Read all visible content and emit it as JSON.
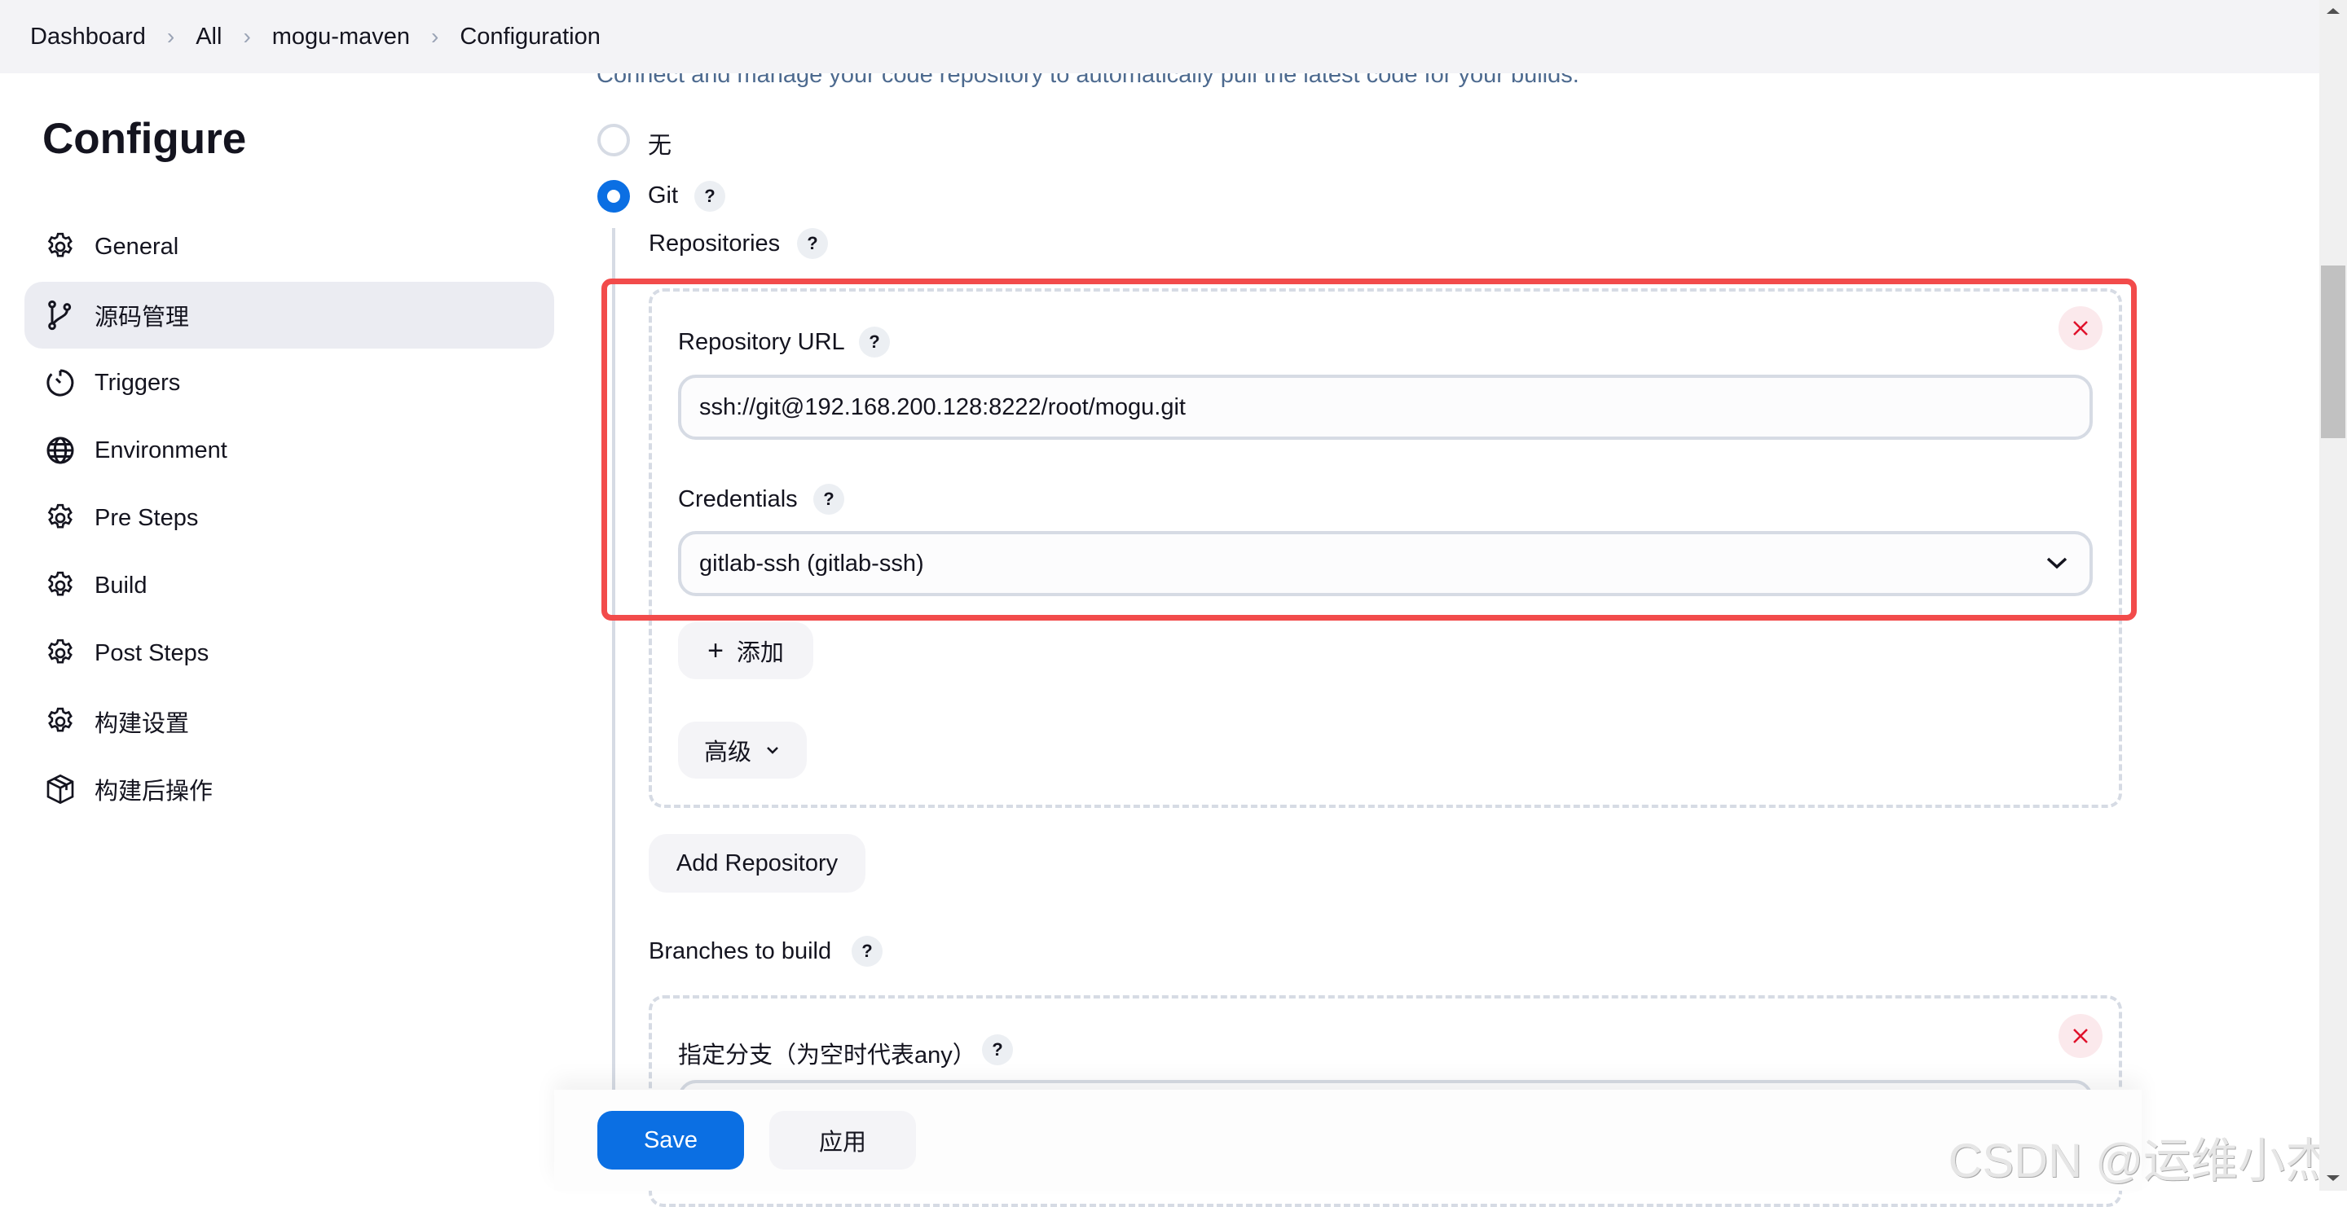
{
  "breadcrumb": [
    "Dashboard",
    "All",
    "mogu-maven",
    "Configuration"
  ],
  "breadcrumb_separator": "›",
  "page_title": "Configure",
  "sidebar": {
    "items": [
      {
        "label": "General",
        "icon": "gear-icon",
        "active": false
      },
      {
        "label": "源码管理",
        "icon": "git-branch-icon",
        "active": true
      },
      {
        "label": "Triggers",
        "icon": "timer-icon",
        "active": false
      },
      {
        "label": "Environment",
        "icon": "globe-icon",
        "active": false
      },
      {
        "label": "Pre Steps",
        "icon": "gear-icon",
        "active": false
      },
      {
        "label": "Build",
        "icon": "gear-icon",
        "active": false
      },
      {
        "label": "Post Steps",
        "icon": "gear-icon",
        "active": false
      },
      {
        "label": "构建设置",
        "icon": "gear-icon",
        "active": false
      },
      {
        "label": "构建后操作",
        "icon": "package-icon",
        "active": false
      }
    ]
  },
  "scm": {
    "description": "Connect and manage your code repository to automatically pull the latest code for your builds.",
    "options": [
      {
        "label": "无",
        "selected": false
      },
      {
        "label": "Git",
        "selected": true
      }
    ],
    "help_glyph": "?",
    "repositories_label": "Repositories",
    "repository": {
      "url_label": "Repository URL",
      "url_value": "ssh://git@192.168.200.128:8222/root/mogu.git",
      "credentials_label": "Credentials",
      "credentials_value": "gitlab-ssh (gitlab-ssh)",
      "add_button": "添加",
      "advanced_button": "高级"
    },
    "add_repository_button": "Add Repository",
    "branches_label": "Branches to build",
    "branch_specifier_label": "指定分支（为空时代表any）"
  },
  "footer": {
    "save_label": "Save",
    "apply_label": "应用"
  },
  "watermark": "CSDN @运维小杰",
  "colors": {
    "accent": "#0b6fe3",
    "highlight_border": "#f24b4b",
    "delete": "#e0112b"
  }
}
